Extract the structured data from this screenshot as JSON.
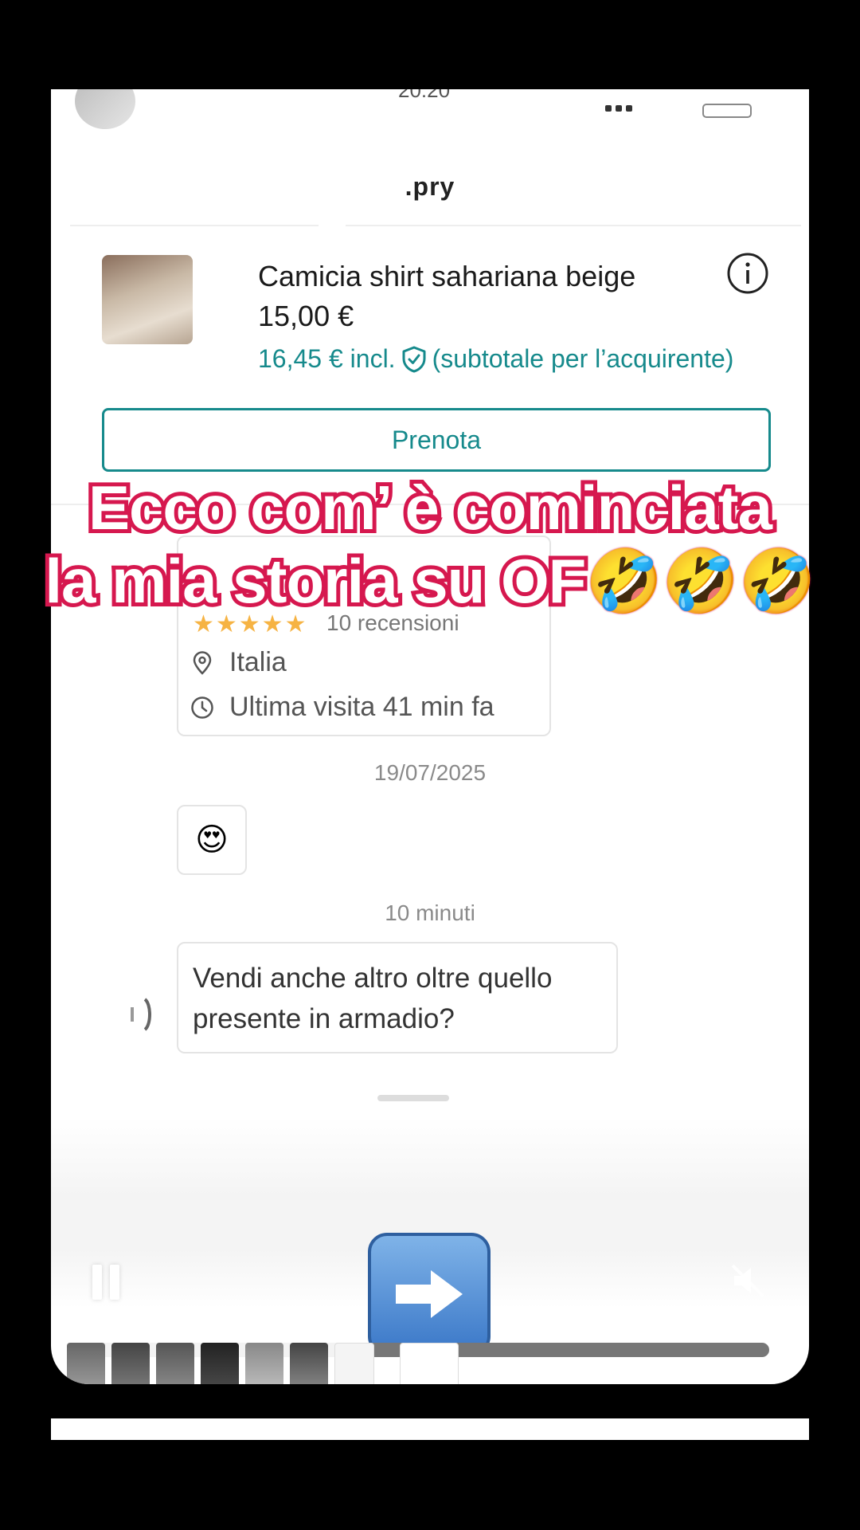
{
  "status_bar": {
    "time": "20:20"
  },
  "header": {
    "title": ".pry"
  },
  "product": {
    "title": "Camicia shirt sahariana beige",
    "price": "15,00 €",
    "price_incl": "16,45 € incl.",
    "subtotal_note": "(subtotale per l’acquirente)"
  },
  "actions": {
    "reserve_label": "Prenota"
  },
  "profile_card": {
    "reviews": "10 recensioni",
    "location": "Italia",
    "last_seen": "Ultima visita 41 min fa"
  },
  "chat": {
    "date_separator": "19/07/2025",
    "emoji_message": "😍",
    "time_separator": "10 minuti",
    "message_line1": "Vendi anche altro oltre quello",
    "message_line2": "presente in armadio?"
  },
  "overlay": {
    "caption_line1": "Ecco com’ è cominciata",
    "caption_line2": "la mia storia su OF",
    "caption_emojis": "🤣🤣🤣"
  },
  "player": {
    "progress": 0.386
  },
  "colors": {
    "accent": "#168a8c",
    "caption_stroke": "#d6184f"
  }
}
